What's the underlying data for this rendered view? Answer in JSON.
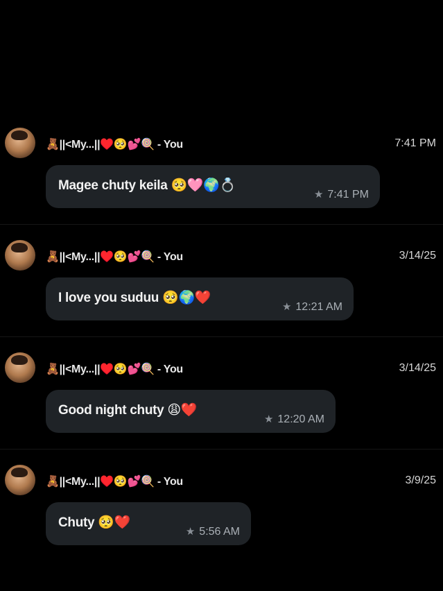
{
  "messages": [
    {
      "sender": "🧸||<My...||♥️🥺💕🍭 - You",
      "date": "7:41 PM",
      "text": "Magee chuty keila 🥺🩷🌍💍",
      "time": "7:41 PM",
      "starred": true
    },
    {
      "sender": "🧸||<My...||♥️🥺💕🍭 - You",
      "date": "3/14/25",
      "text": "I love you suduu 🥺🌍❤️",
      "time": "12:21 AM",
      "starred": true
    },
    {
      "sender": "🧸||<My...||♥️🥺💕🍭 - You",
      "date": "3/14/25",
      "text": "Good night chuty 😩❤️",
      "time": "12:20 AM",
      "starred": true
    },
    {
      "sender": "🧸||<My...||♥️🥺💕🍭 - You",
      "date": "3/9/25",
      "text": "Chuty 🥺❤️",
      "time": "5:56 AM",
      "starred": true
    }
  ],
  "icons": {
    "star": "star-icon",
    "avatar": "avatar"
  },
  "colors": {
    "background": "#000000",
    "bubble": "#1f2327",
    "meta_text": "#aab0b6"
  }
}
